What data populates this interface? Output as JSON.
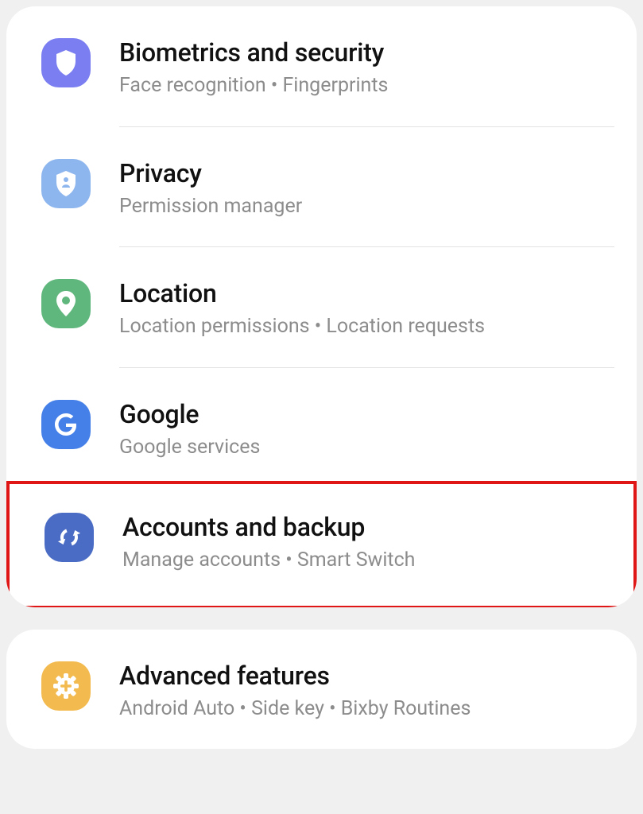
{
  "settings_groups": [
    {
      "items": [
        {
          "id": "biometrics",
          "title": "Biometrics and security",
          "subtitle": "Face recognition  •  Fingerprints",
          "icon": "shield-icon",
          "color": "purple"
        },
        {
          "id": "privacy",
          "title": "Privacy",
          "subtitle": "Permission manager",
          "icon": "privacy-shield-icon",
          "color": "lightblue"
        },
        {
          "id": "location",
          "title": "Location",
          "subtitle": "Location permissions  •  Location requests",
          "icon": "location-pin-icon",
          "color": "green"
        },
        {
          "id": "google",
          "title": "Google",
          "subtitle": "Google services",
          "icon": "google-g-icon",
          "color": "blue"
        },
        {
          "id": "accounts",
          "title": "Accounts and backup",
          "subtitle": "Manage accounts  •  Smart Switch",
          "icon": "sync-icon",
          "color": "navy",
          "highlighted": true
        }
      ]
    },
    {
      "items": [
        {
          "id": "advanced",
          "title": "Advanced features",
          "subtitle": "Android Auto  •  Side key  •  Bixby Routines",
          "icon": "plus-gear-icon",
          "color": "yellow"
        }
      ]
    }
  ]
}
